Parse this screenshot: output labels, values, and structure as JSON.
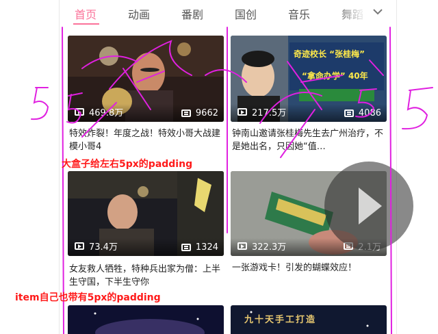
{
  "tabs": [
    "首页",
    "动画",
    "番剧",
    "国创",
    "音乐",
    "舞蹈"
  ],
  "videos": [
    {
      "views": "469.8万",
      "danmaku": "9662",
      "title": "特效炸裂！年度之战！特效小哥大战建模小哥4"
    },
    {
      "views": "217.5万",
      "danmaku": "4086",
      "title": "钟南山邀请张桂梅先生去广州治疗，不是她出名，只因她“值…"
    },
    {
      "views": "73.4万",
      "danmaku": "1324",
      "title": "女友救人牺牲，特种兵出家为僧：上半生守国，下半生守你"
    },
    {
      "views": "322.3万",
      "danmaku": "2.1万",
      "title": "一张游戏卡！引发的蝴蝶效应！"
    }
  ],
  "thumb_text": {
    "card2_line1": "奇迹校长 “张桂梅”",
    "card2_line2": "“拿命办学” 40年",
    "card6_line": "九十天手工打造"
  },
  "annotations": {
    "outer": "大盒子给左右5px的padding",
    "inner": "item自己也带有5px的padding"
  },
  "colors": {
    "accent": "#fb7299",
    "annotation": "#ff1a1a",
    "sketch": "#e020e0"
  }
}
